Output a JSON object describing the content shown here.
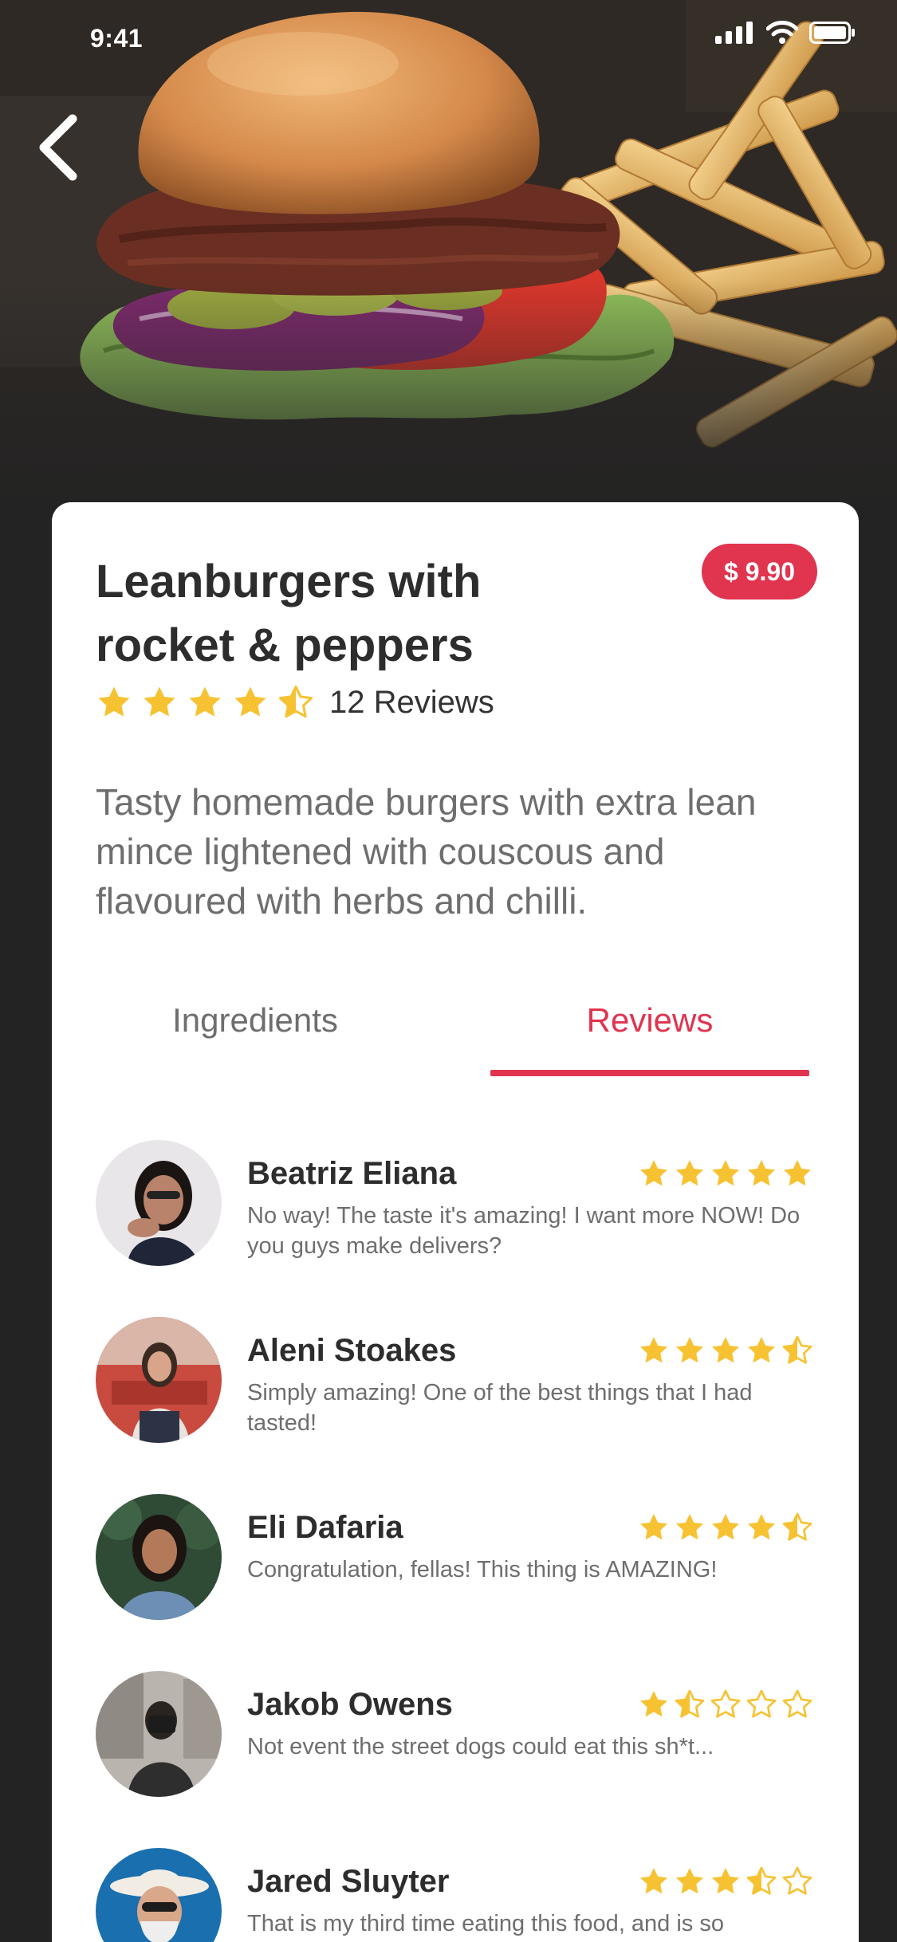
{
  "status_bar": {
    "time": "9:41",
    "icons": [
      "signal-icon",
      "wifi-icon",
      "battery-icon"
    ]
  },
  "navigation": {
    "back_icon": "chevron-left-icon"
  },
  "hero": {
    "image": "burger-and-fries-photo"
  },
  "product": {
    "title": "Leanburgers with rocket & peppers",
    "price": "$ 9.90",
    "rating": 4.5,
    "reviews_count_label": "12 Reviews",
    "description": "Tasty homemade burgers with extra lean mince lightened with couscous and flavoured with herbs and chilli."
  },
  "tabs": [
    {
      "label": "Ingredients",
      "active": false
    },
    {
      "label": "Reviews",
      "active": true
    }
  ],
  "reviews": [
    {
      "name": "Beatriz Eliana",
      "rating": 5,
      "text": "No way! The taste it's amazing! I want more NOW! Do you guys make delivers?",
      "avatar": "avatar-beatriz"
    },
    {
      "name": "Aleni Stoakes",
      "rating": 4.5,
      "text": "Simply amazing! One of the best things that I had tasted!",
      "avatar": "avatar-aleni"
    },
    {
      "name": "Eli Dafaria",
      "rating": 4.5,
      "text": "Congratulation, fellas! This thing is AMAZING!",
      "avatar": "avatar-eli"
    },
    {
      "name": "Jakob Owens",
      "rating": 1.5,
      "text": "Not event the street dogs could eat this sh*t...",
      "avatar": "avatar-jakob"
    },
    {
      "name": "Jared Sluyter",
      "rating": 3.5,
      "text": "That is my third time eating this food, and is so",
      "avatar": "avatar-jared"
    }
  ],
  "colors": {
    "accent": "#e0344f",
    "star": "#f7c232",
    "background": "#232323",
    "card": "#ffffff",
    "title_text": "#2d2d2d",
    "body_text": "#6e6e6e"
  }
}
